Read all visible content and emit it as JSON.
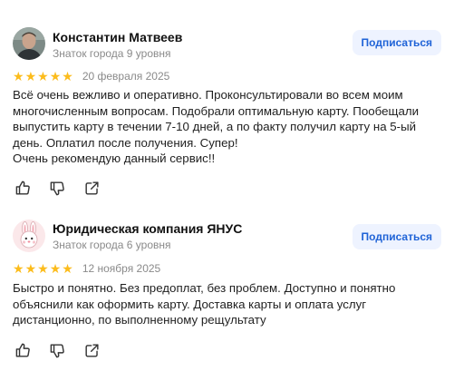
{
  "reviews": [
    {
      "author": "Константин Матвеев",
      "level": "Знаток города 9 уровня",
      "subscribe_label": "Подписаться",
      "rating": 5,
      "date": "20 февраля 2025",
      "text_lines": [
        "Всё очень вежливо и оперативно. Проконсультировали во всем моим",
        "многочисленным вопросам. Подобрали оптимальную карту. Пообещали",
        "выпустить карту в течении 7-10 дней, а по факту получил карту на 5-ый",
        "день. Оплатил после получения. Супер!",
        "Очень рекомендую данный сервис!!"
      ],
      "avatar_icon": "person-photo-icon"
    },
    {
      "author": "Юридическая компания ЯНУС",
      "level": "Знаток города 6 уровня",
      "subscribe_label": "Подписаться",
      "rating": 5,
      "date": "12 ноября 2025",
      "text_lines": [
        "Быстро и понятно. Без предоплат, без проблем. Доступно и понятно",
        "объяснили как оформить карту. Доставка карты и оплата услуг",
        "дистанционно, по выполненному рещультату"
      ],
      "avatar_icon": "bunny-icon"
    }
  ],
  "actions": {
    "like_icon": "thumb-up-icon",
    "dislike_icon": "thumb-down-icon",
    "share_icon": "share-icon"
  },
  "colors": {
    "star": "#fcbc1c",
    "accent": "#1f63d7",
    "subscribe_bg": "#eef3ff",
    "muted": "#8a8a8a"
  }
}
